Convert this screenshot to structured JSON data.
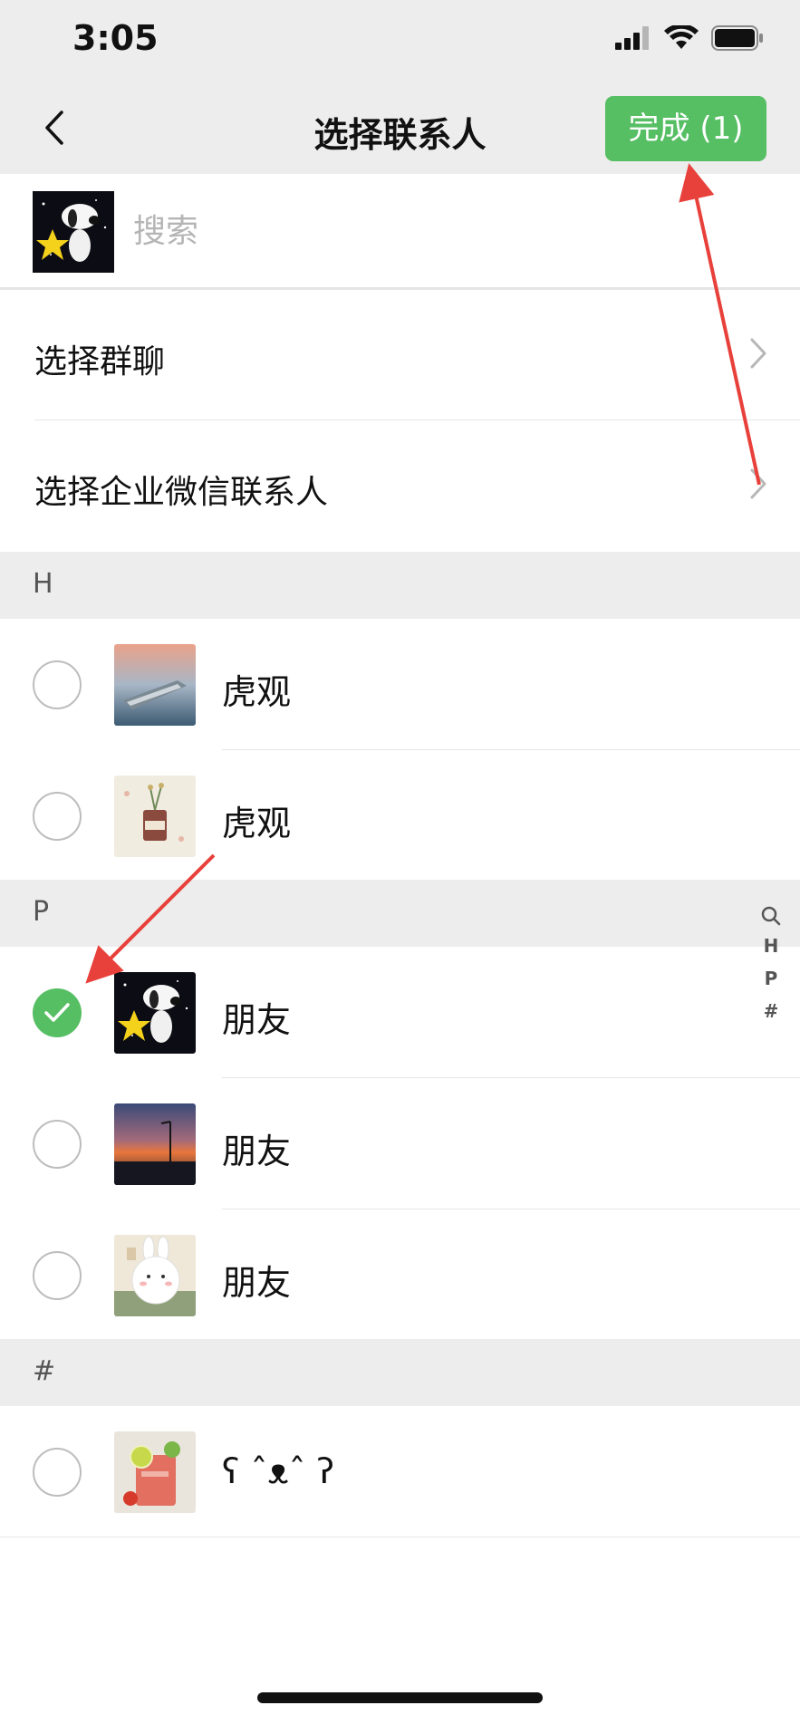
{
  "status_bar": {
    "time": "3:05"
  },
  "nav": {
    "title": "选择联系人",
    "done_label": "完成 (1)"
  },
  "search": {
    "placeholder": "搜索"
  },
  "menu": [
    {
      "label": "选择群聊"
    },
    {
      "label": "选择企业微信联系人"
    }
  ],
  "sections": [
    {
      "letter": "H",
      "contacts": [
        {
          "name": "虎观",
          "checked": false
        },
        {
          "name": "虎观",
          "checked": false
        }
      ]
    },
    {
      "letter": "P",
      "contacts": [
        {
          "name": "朋友",
          "checked": true
        },
        {
          "name": "朋友",
          "checked": false
        },
        {
          "name": "朋友",
          "checked": false
        }
      ]
    },
    {
      "letter": "#",
      "contacts": [
        {
          "name": "ʕ ˆᴥˆ ʔ",
          "checked": false
        }
      ]
    }
  ],
  "index_bar": [
    "H",
    "P",
    "#"
  ],
  "colors": {
    "accent": "#56be63",
    "annotation": "#e8403a"
  },
  "icons": {
    "back": "chevron-left-icon",
    "row": "chevron-right-icon",
    "index_search": "search-icon"
  }
}
